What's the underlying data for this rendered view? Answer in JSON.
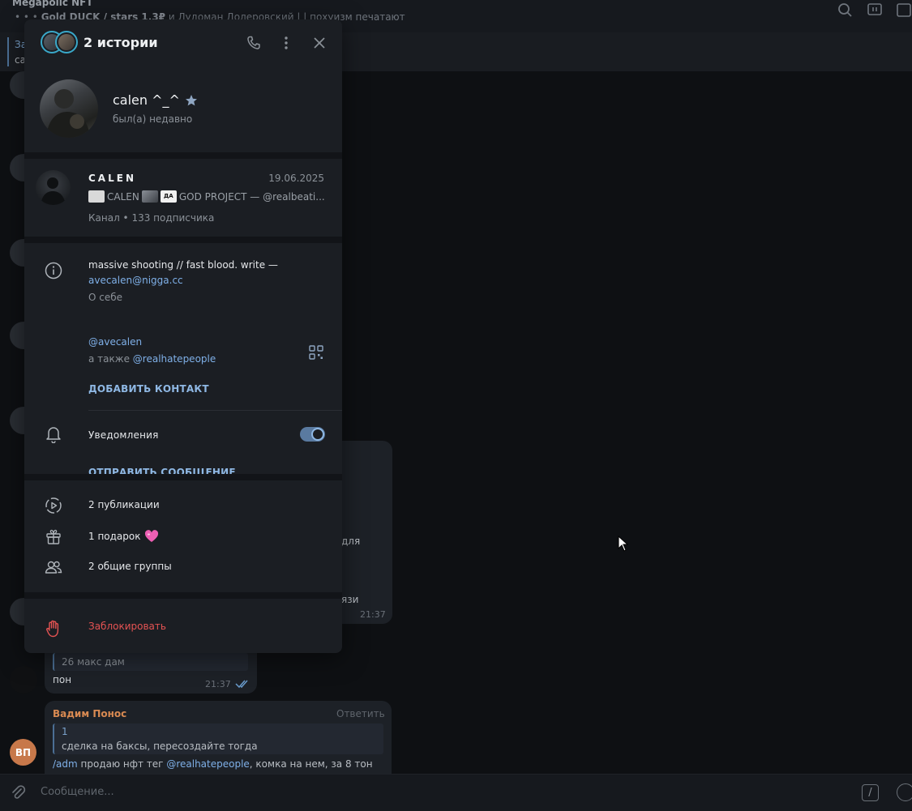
{
  "background_chat": {
    "title": "Megapolic NFT",
    "subtitle_bold": "Gold DUCK / stars 1.3₽",
    "subtitle_rest": "и Лудоман Долеровский | | похуизм печатают",
    "pinned_title": "За",
    "pinned_text": "са",
    "msg_fragment_1": "для",
    "msg_fragment_2": "язи",
    "time_1": "21:37",
    "quote_text": "26 макс дам",
    "message_text": "пон",
    "time_2": "21:37",
    "reply_author": "Вадим Понос",
    "reply_action": "Ответить",
    "reply_quote_num": "1",
    "reply_quote_text": "сделка на баксы, пересоздайте тогда",
    "reply_cmd": "/adm",
    "reply_text_1": "продаю нфт тег",
    "reply_mention": "@realhatepeople",
    "reply_text_2": ", комка на нем, за 8 тон",
    "reply_avatar_initials": "ВП",
    "composer_placeholder": "Сообщение..."
  },
  "panel": {
    "header_title": "2 истории",
    "profile": {
      "name": "calen ^_^",
      "status": "был(а) недавно"
    },
    "channel": {
      "name": "CALEN",
      "date": "19.06.2025",
      "desc_1": "CALEN",
      "desc_2": "GOD PROJECT — @realbeati...",
      "mini_label": "ДА",
      "meta": "Канал • 133 подписчика"
    },
    "info": {
      "bio_text": "massive shooting // fast blood. write —",
      "bio_link": "avecalen@nigga.cc",
      "bio_label": "О себе",
      "username": "@avecalen",
      "also_label": "а также",
      "also_username": "@realhatepeople",
      "add_contact": "ДОБАВИТЬ КОНТАКТ",
      "notifications": "Уведомления",
      "send_message": "ОТПРАВИТЬ СООБЩЕНИЕ"
    },
    "lists": {
      "publications": "2 публикации",
      "gifts": "1 подарок",
      "groups": "2 общие группы"
    },
    "block": "Заблокировать"
  },
  "colors": {
    "accent": "#8fb8e4",
    "link": "#7fb0e8",
    "danger": "#e55353",
    "panel_bg": "#1b1e23",
    "story_ring": "#3aa8c9"
  },
  "icons": {
    "phone": "phone-icon",
    "more": "more-vertical-icon",
    "close": "close-icon",
    "verified": "star-badge-icon",
    "info": "info-icon",
    "qr": "qr-code-icon",
    "bell": "bell-icon",
    "stories": "stories-icon",
    "gift": "gift-icon",
    "heart": "pink-heart-emoji",
    "groups": "users-icon",
    "block": "hand-stop-icon"
  }
}
